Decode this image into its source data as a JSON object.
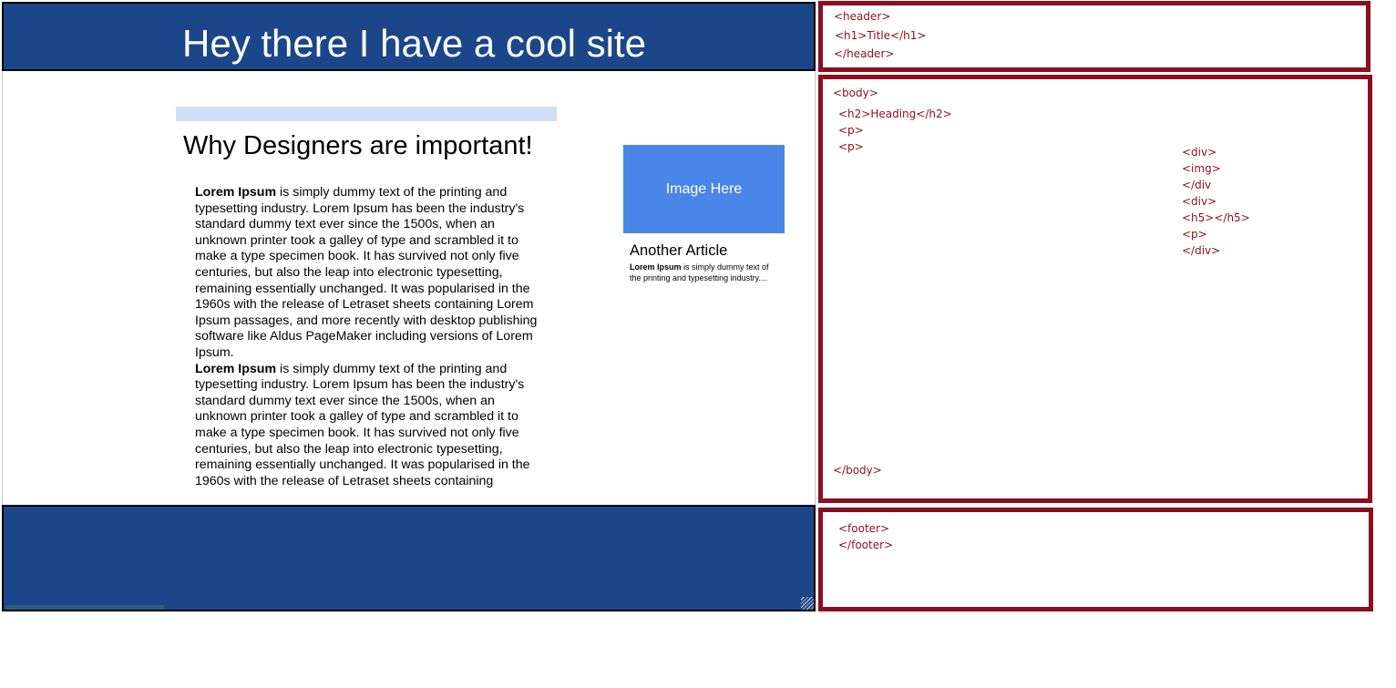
{
  "mockup": {
    "header": {
      "title": "Hey there I have a cool site"
    },
    "main": {
      "heading": "Why Designers are important!",
      "paragraphs": [
        {
          "bold": "Lorem Ipsum",
          "text": " is simply dummy text of the printing and typesetting industry. Lorem Ipsum has been the industry's standard dummy text ever since the 1500s, when an unknown printer took a galley of type and scrambled it to make a type specimen book. It has survived not only five centuries, but also the leap into electronic typesetting, remaining essentially unchanged. It was popularised in the 1960s with the release of Letraset sheets containing Lorem Ipsum passages, and more recently with desktop publishing software like Aldus PageMaker including versions of Lorem Ipsum."
        },
        {
          "bold": "Lorem Ipsum",
          "text": " is simply dummy text of the printing and typesetting industry. Lorem Ipsum has been the industry's standard dummy text ever since the 1500s, when an unknown printer took a galley of type and scrambled it to make a type specimen book. It has survived not only five centuries, but also the leap into electronic typesetting, remaining essentially unchanged. It was popularised in the 1960s with the release of Letraset sheets containing"
        }
      ]
    },
    "side": {
      "image_label": "Image Here",
      "heading": "Another Article",
      "text_bold": "Lorem Ipsum",
      "text": " is simply dummy text of the printing and typesetting industry...."
    }
  },
  "annotations": {
    "header_lines": [
      "<header>",
      "<h1>Title</h1>",
      "</header>"
    ],
    "body_lines": [
      "<body>",
      "<h2>Heading</h2>",
      "<p>",
      "<p>"
    ],
    "side_lines": [
      "<div>",
      "<img>",
      "</div",
      "<div>",
      "<h5></h5>",
      "<p>",
      "</div>"
    ],
    "body_close": "</body>",
    "footer_lines": [
      "<footer>",
      "</footer>"
    ]
  },
  "colors": {
    "header_bg": "#1c468a",
    "image_placeholder": "#4a86e8",
    "accent_bar": "#cfe0f6",
    "annotation_border": "#8b0f1f"
  }
}
